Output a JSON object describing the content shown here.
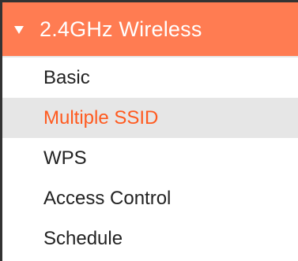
{
  "header": {
    "title": "2.4GHz Wireless",
    "icon": "triangle-down-icon"
  },
  "menu": {
    "items": [
      {
        "label": "Basic",
        "active": false
      },
      {
        "label": "Multiple SSID",
        "active": true
      },
      {
        "label": "WPS",
        "active": false
      },
      {
        "label": "Access Control",
        "active": false
      },
      {
        "label": "Schedule",
        "active": false
      }
    ]
  },
  "colors": {
    "header_bg": "#ff7c52",
    "header_text": "#ffffff",
    "active_bg": "#e6e6e6",
    "active_text": "#ff5a1f",
    "item_text": "#222222"
  }
}
